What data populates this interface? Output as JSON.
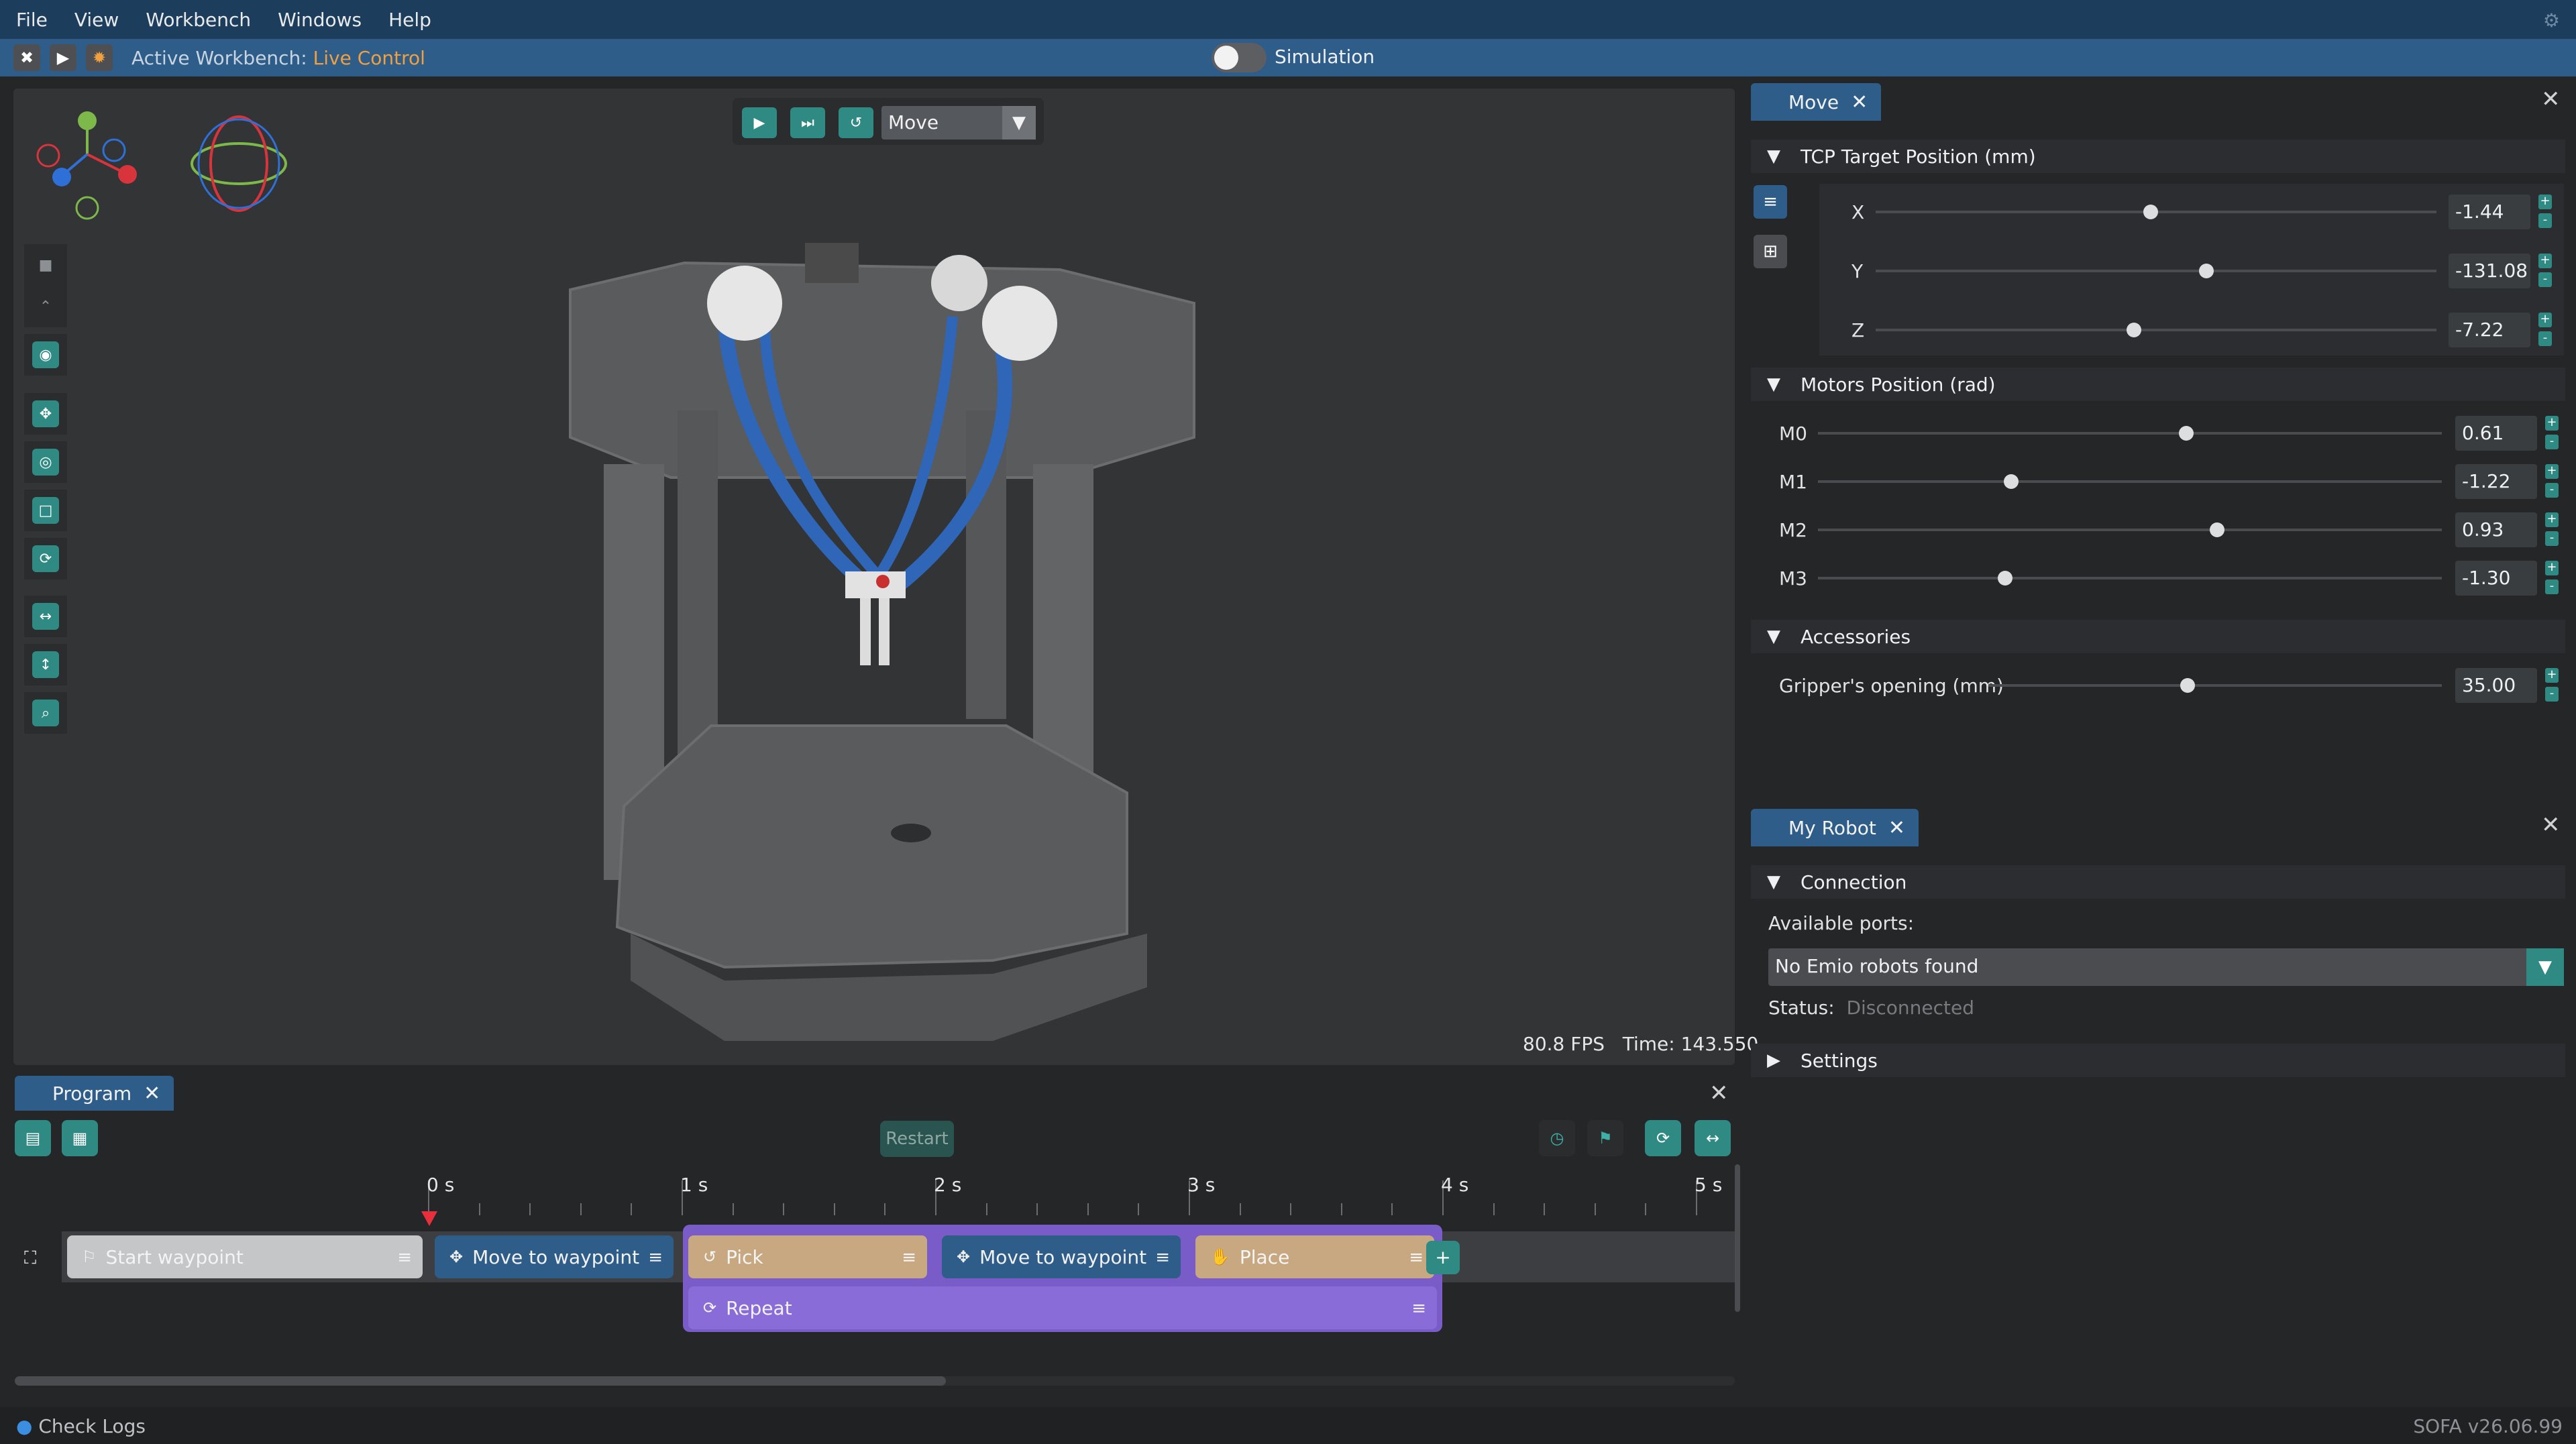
{
  "menu": [
    "File",
    "View",
    "Workbench",
    "Windows",
    "Help"
  ],
  "toolbar": {
    "active_workbench_label": "Active Workbench:",
    "active_workbench_value": "Live Control",
    "simulation_label": "Simulation"
  },
  "viewport": {
    "mode_select": "Move",
    "fps": "80.8 FPS",
    "time": "Time: 143.550"
  },
  "move_panel": {
    "tab": "Move",
    "tcp": {
      "title": "TCP Target Position (mm)",
      "axes": [
        {
          "label": "X",
          "value": "-1.44",
          "fraction": 0.49
        },
        {
          "label": "Y",
          "value": "-131.08",
          "fraction": 0.59
        },
        {
          "label": "Z",
          "value": "-7.22",
          "fraction": 0.46
        }
      ]
    },
    "motors": {
      "title": "Motors Position (rad)",
      "items": [
        {
          "label": "M0",
          "value": "0.61",
          "fraction": 0.59
        },
        {
          "label": "M1",
          "value": "-1.22",
          "fraction": 0.31
        },
        {
          "label": "M2",
          "value": "0.93",
          "fraction": 0.64
        },
        {
          "label": "M3",
          "value": "-1.30",
          "fraction": 0.3
        }
      ]
    },
    "accessories": {
      "title": "Accessories",
      "items": [
        {
          "label": "Gripper's opening (mm)",
          "value": "35.00",
          "fraction": 0.44
        }
      ]
    }
  },
  "robot_panel": {
    "tab": "My Robot",
    "connection_title": "Connection",
    "ports_label": "Available ports:",
    "ports_value": "No Emio robots found",
    "status_label": "Status:",
    "status_value": "Disconnected",
    "settings_title": "Settings"
  },
  "program": {
    "tab": "Program",
    "restart": "Restart",
    "ticks": [
      "0 s",
      "1 s",
      "2 s",
      "3 s",
      "4 s",
      "5 s"
    ],
    "blocks": {
      "start": "Start waypoint",
      "move1": "Move to waypoint",
      "pick": "Pick",
      "move2": "Move to waypoint",
      "place": "Place",
      "repeat": "Repeat",
      "add": "+"
    }
  },
  "status": {
    "check_logs": "Check Logs",
    "version": "SOFA v26.06.99"
  },
  "colors": {
    "menubar": "#1d3d5c",
    "accent": "#2e5d8a",
    "teal": "#2f8a84",
    "orange": "#f0a040"
  }
}
